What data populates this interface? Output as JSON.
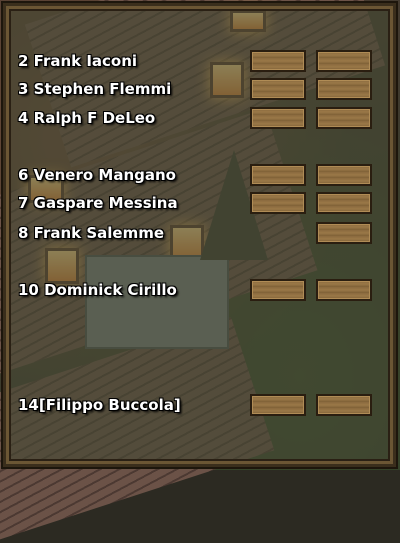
{
  "roster": [
    {
      "slot": "2",
      "name": "2 Frank Iaconi",
      "buttons": 2
    },
    {
      "slot": "3",
      "name": "3 Stephen Flemmi",
      "buttons": 2
    },
    {
      "slot": "4",
      "name": "4 Ralph F DeLeo",
      "buttons": 2
    },
    {
      "slot": "6",
      "name": "6 Venero Mangano",
      "buttons": 2
    },
    {
      "slot": "7",
      "name": "7 Gaspare Messina",
      "buttons": 2
    },
    {
      "slot": "8",
      "name": "8 Frank Salemme",
      "buttons": 1
    },
    {
      "slot": "10",
      "name": "10 Dominick Cirillo",
      "buttons": 2
    },
    {
      "slot": "14",
      "name": "14[Filippo Buccola]",
      "buttons": 2
    }
  ]
}
